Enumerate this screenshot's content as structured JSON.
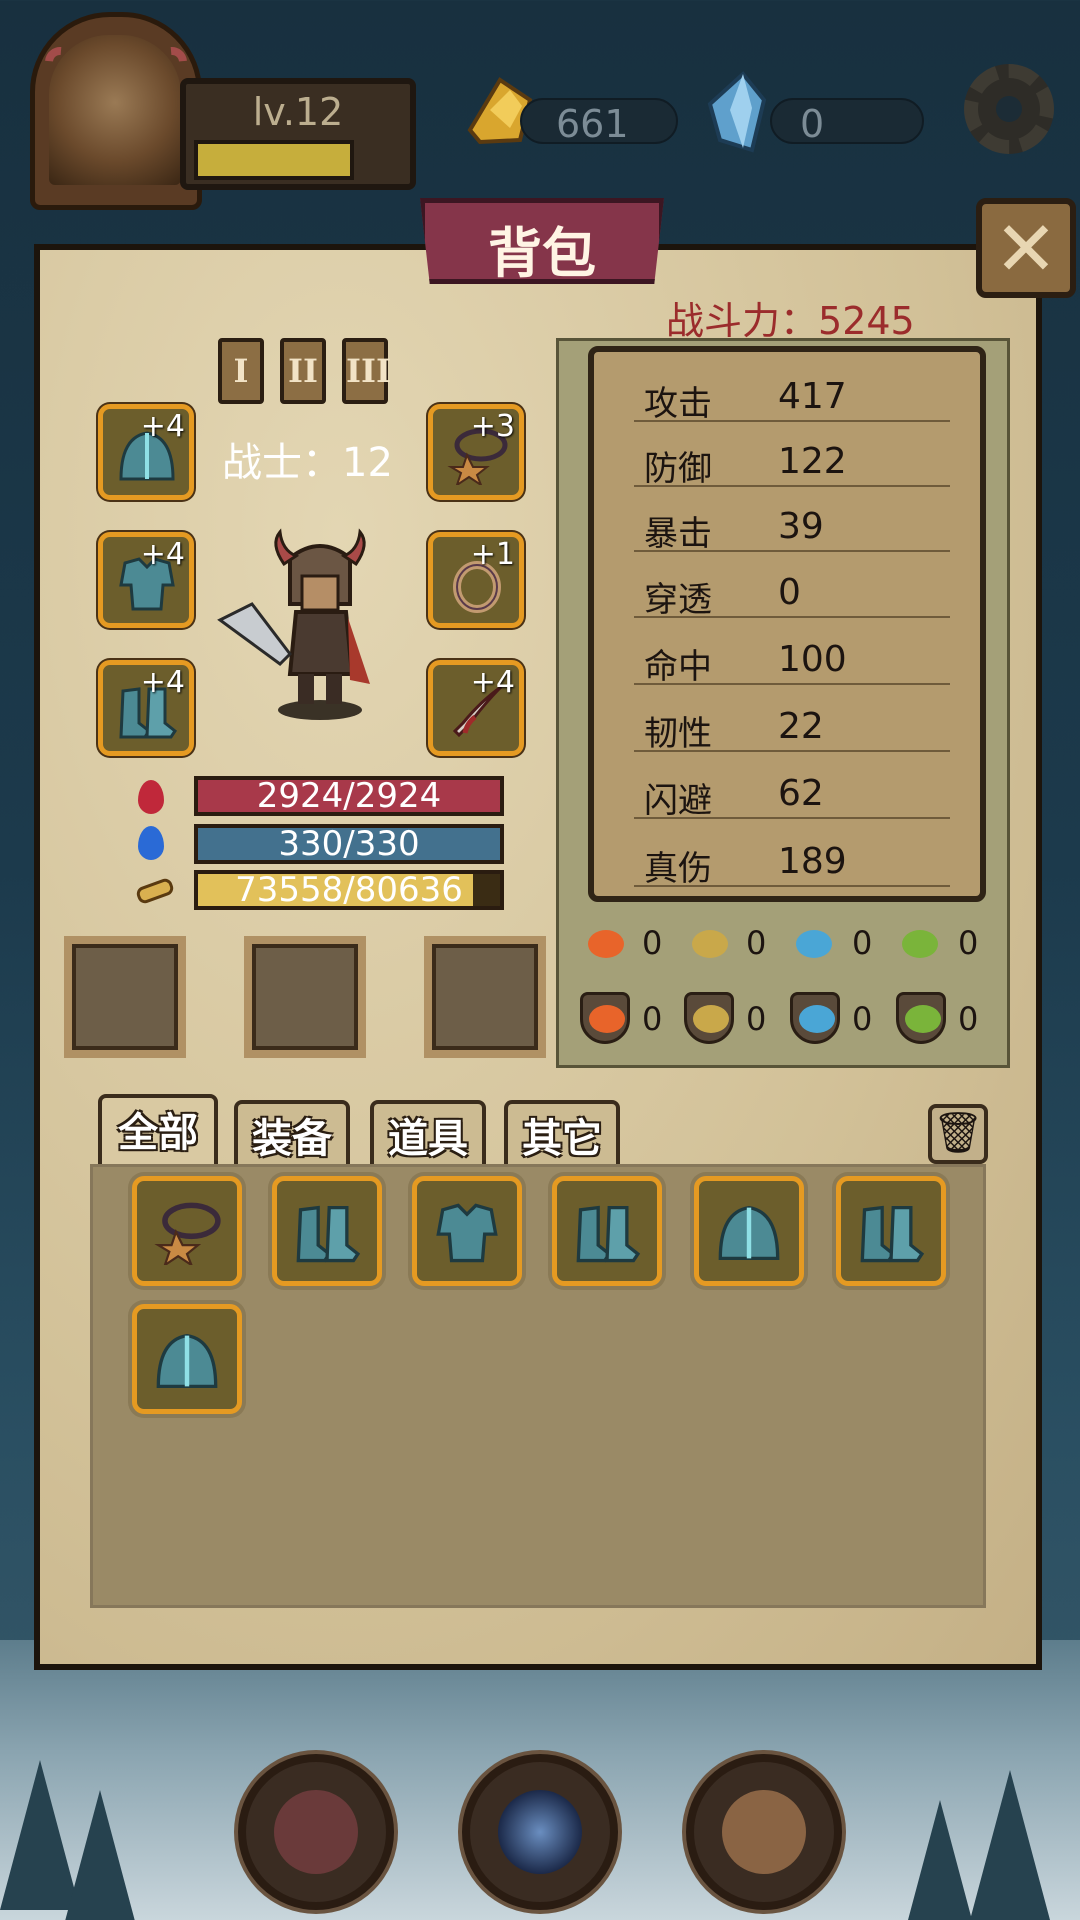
{
  "topbar": {
    "level": "lv.12",
    "level_progress": 0.8,
    "gold": "661",
    "crystal": "0"
  },
  "panel": {
    "title": "背包",
    "power_label": "战斗力：",
    "power_value": "5245",
    "close_label": "✕"
  },
  "hero": {
    "tiers": [
      "I",
      "II",
      "III"
    ],
    "class_label": "战士：",
    "class_level": "12",
    "hp": "2924/2924",
    "mp": "330/330",
    "exp": "73558/80636",
    "exp_fraction": 0.912
  },
  "equipment": {
    "left": [
      {
        "name": "helmet",
        "plus": "+4"
      },
      {
        "name": "armor",
        "plus": "+4"
      },
      {
        "name": "boots",
        "plus": "+4"
      }
    ],
    "right": [
      {
        "name": "necklace",
        "plus": "+3"
      },
      {
        "name": "ring",
        "plus": "+1"
      },
      {
        "name": "weapon",
        "plus": "+4"
      }
    ]
  },
  "stats": [
    {
      "name": "攻击",
      "value": "417"
    },
    {
      "name": "防御",
      "value": "122"
    },
    {
      "name": "暴击",
      "value": "39"
    },
    {
      "name": "穿透",
      "value": "0"
    },
    {
      "name": "命中",
      "value": "100"
    },
    {
      "name": "韧性",
      "value": "22"
    },
    {
      "name": "闪避",
      "value": "62"
    },
    {
      "name": "真伤",
      "value": "189"
    }
  ],
  "elements": {
    "row1": [
      "0",
      "0",
      "0",
      "0"
    ],
    "row2": [
      "0",
      "0",
      "0",
      "0"
    ]
  },
  "tabs": [
    "全部",
    "装备",
    "道具",
    "其它"
  ],
  "colors": {
    "hp": "#a8394a",
    "mp": "#43718e",
    "exp": "#e2c15a",
    "item_border": "#e59a22",
    "power": "#9b2c2c"
  }
}
